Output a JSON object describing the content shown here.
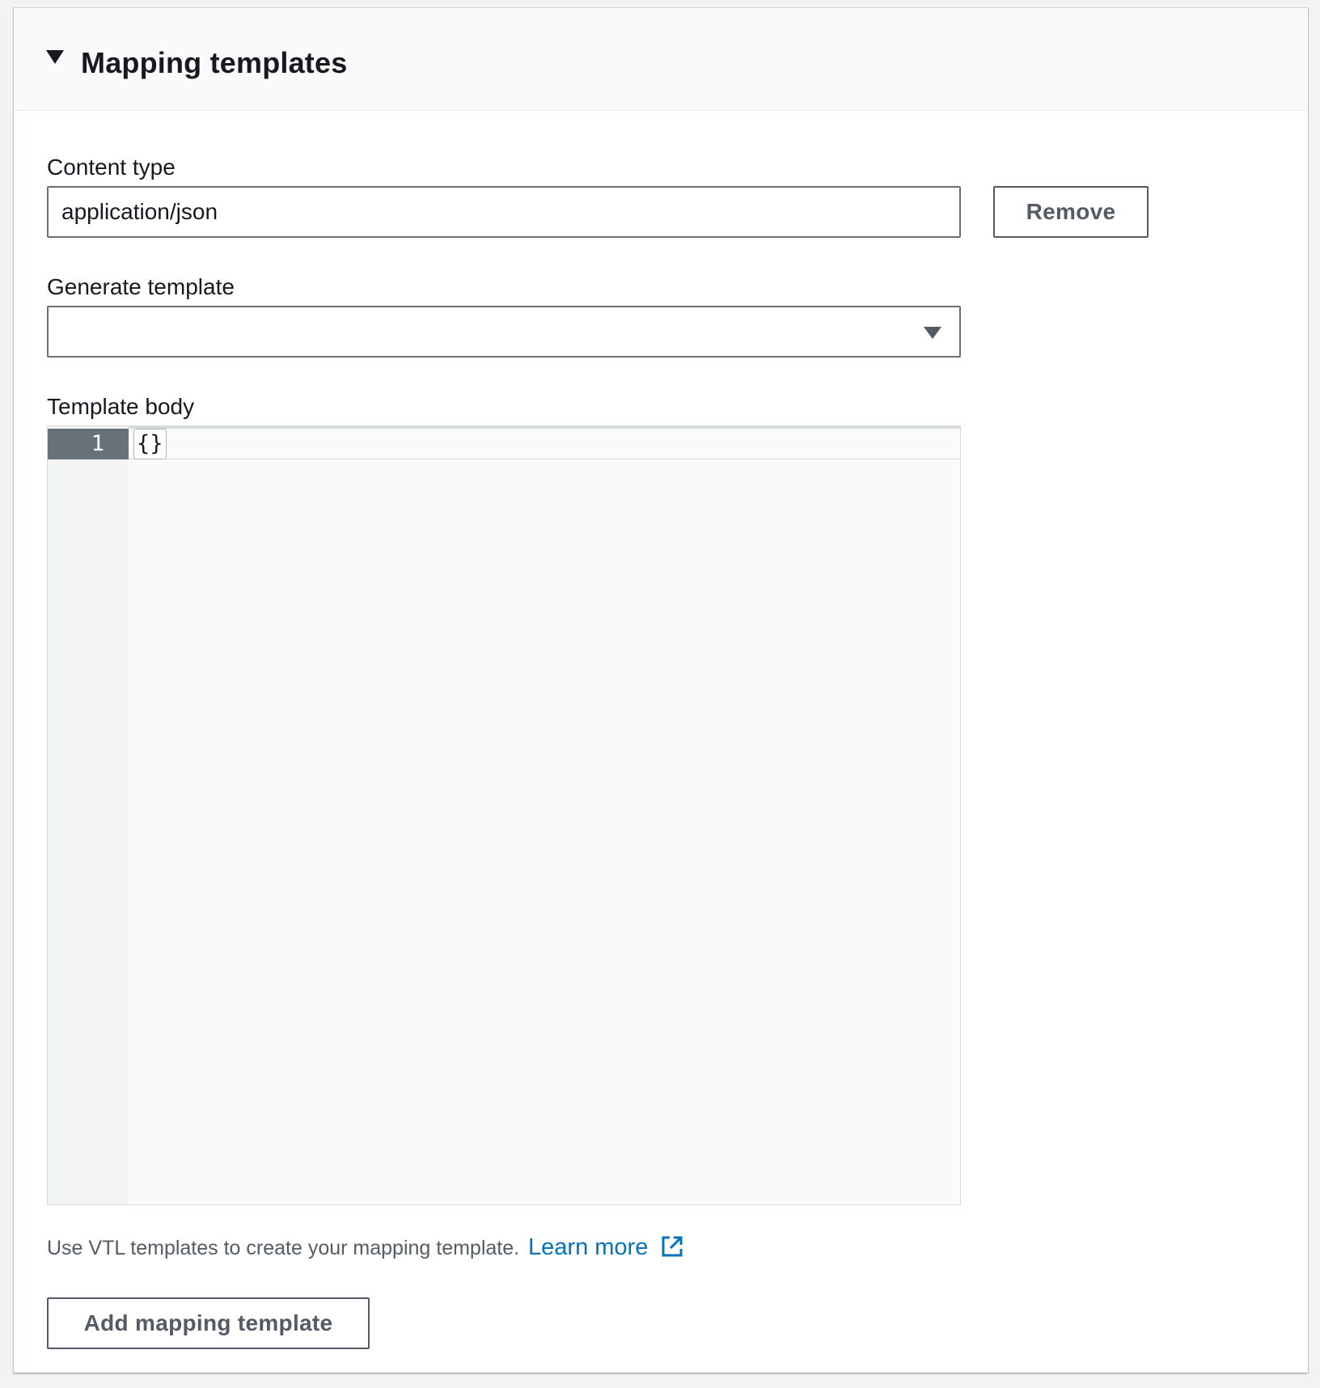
{
  "section": {
    "title": "Mapping templates",
    "caret_icon": "caret-down-icon"
  },
  "content_type": {
    "label": "Content type",
    "value": "application/json",
    "remove_label": "Remove"
  },
  "generate_template": {
    "label": "Generate template",
    "selected": "",
    "caret_icon": "caret-down-icon"
  },
  "template_body": {
    "label": "Template body",
    "line_number": "1",
    "code": "{}"
  },
  "hint": {
    "text": "Use VTL templates to create your mapping template.",
    "link_label": "Learn more",
    "link_icon": "external-link-icon",
    "link_color": "#0073bb"
  },
  "add_button": {
    "label": "Add mapping template"
  }
}
